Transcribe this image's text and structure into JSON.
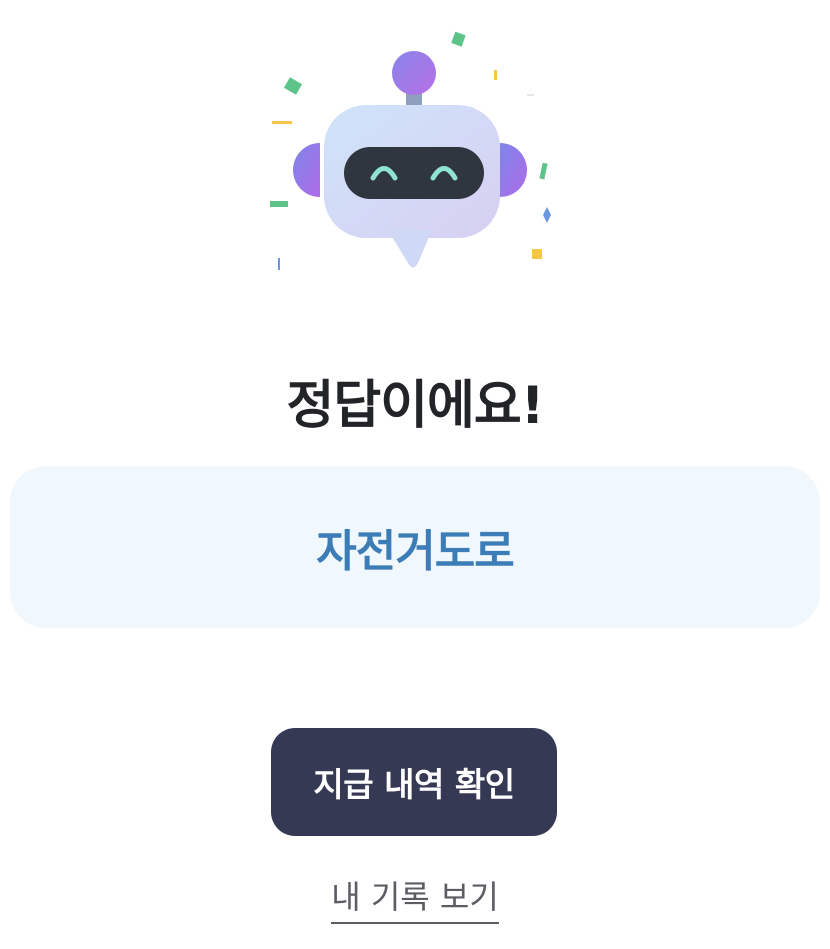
{
  "mascot": {
    "icon": "robot-mascot-icon",
    "confetti_colors": [
      "#5cc489",
      "#f6c64b",
      "#6a98e0",
      "#ffcc55"
    ]
  },
  "result": {
    "headline": "정답이에요!"
  },
  "answer": {
    "text": "자전거도로"
  },
  "actions": {
    "primary_label": "지급 내역 확인",
    "secondary_label": "내 기록 보기"
  },
  "colors": {
    "headline": "#222428",
    "answer_text": "#3c7db7",
    "answer_card_bg": "#f0f8fd",
    "button_bg": "#353953",
    "button_text": "#ffffff",
    "link_text": "#5b5d63"
  }
}
